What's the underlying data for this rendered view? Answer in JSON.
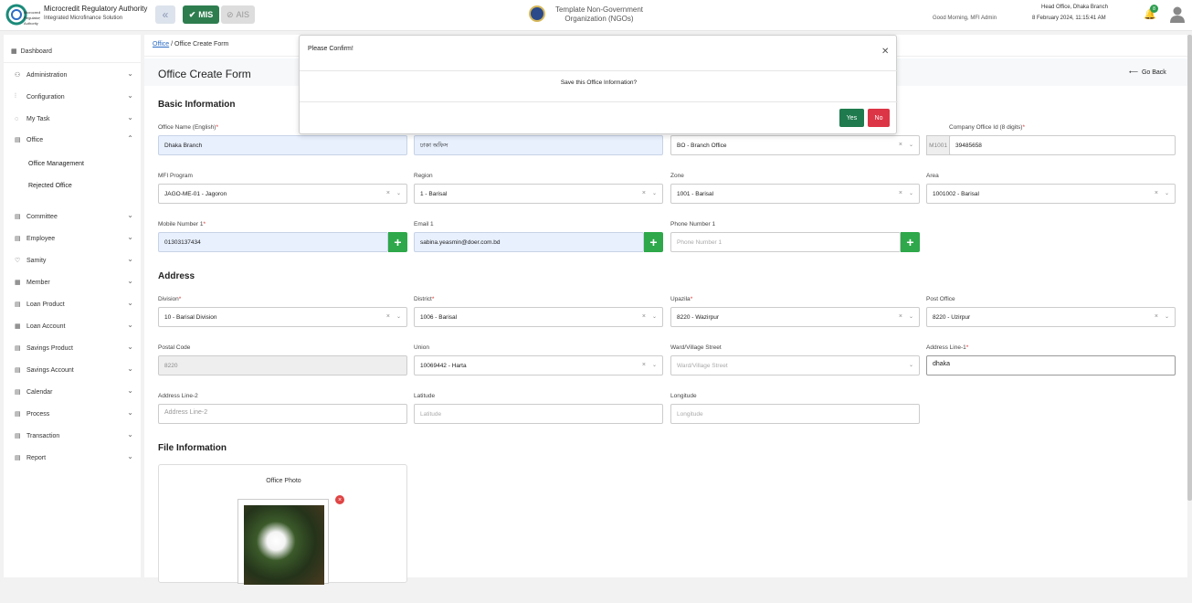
{
  "header": {
    "brand_title": "Microcredit Regulatory Authority",
    "brand_subtitle": "Integrated Microfinance Solution",
    "mis_label": "MIS",
    "ais_label": "AIS",
    "org_name": "Template Non-Government Organization (NGOs)",
    "greeting": "Good Morning, MFI Admin",
    "branch": "Head Office, Dhaka Branch",
    "datetime": "8 February 2024, 11:15:41 AM",
    "notification_count": "8"
  },
  "sidebar": {
    "dashboard": "Dashboard",
    "items": [
      {
        "label": "Administration",
        "icon": "users-icon"
      },
      {
        "label": "Configuration",
        "icon": "sliders-icon"
      },
      {
        "label": "My Task",
        "icon": "task-icon"
      },
      {
        "label": "Office",
        "icon": "office-icon"
      },
      {
        "label": "Committee",
        "icon": "committee-icon"
      },
      {
        "label": "Employee",
        "icon": "employee-icon"
      },
      {
        "label": "Samity",
        "icon": "samity-icon"
      },
      {
        "label": "Member",
        "icon": "member-icon"
      },
      {
        "label": "Loan Product",
        "icon": "loan-product-icon"
      },
      {
        "label": "Loan Account",
        "icon": "loan-account-icon"
      },
      {
        "label": "Savings Product",
        "icon": "savings-product-icon"
      },
      {
        "label": "Savings Account",
        "icon": "savings-account-icon"
      },
      {
        "label": "Calendar",
        "icon": "calendar-icon"
      },
      {
        "label": "Process",
        "icon": "process-icon"
      },
      {
        "label": "Transaction",
        "icon": "transaction-icon"
      },
      {
        "label": "Report",
        "icon": "report-icon"
      }
    ],
    "office_submenu": [
      "Office Management",
      "Rejected Office"
    ]
  },
  "breadcrumb": {
    "parent": "Office",
    "current": "Office Create Form"
  },
  "page": {
    "title": "Office Create Form",
    "go_back": "Go Back"
  },
  "sections": {
    "basic": "Basic Information",
    "address": "Address",
    "file": "File Information"
  },
  "form": {
    "office_name_en": {
      "label": "Office Name (English)",
      "value": "Dhaka Branch"
    },
    "office_name_bn": {
      "value": "ঢাকা অফিস"
    },
    "office_type": {
      "value": "BO - Branch Office"
    },
    "company_office_id": {
      "label": "Company Office Id (8 digits)",
      "prefix": "M1001",
      "value": "39485658"
    },
    "mfi_program": {
      "label": "MFI Program",
      "value": "JAGO-ME-01 - Jagoron"
    },
    "region": {
      "label": "Region",
      "value": "1 - Barisal"
    },
    "zone": {
      "label": "Zone",
      "value": "1001 - Barisal"
    },
    "area": {
      "label": "Area",
      "value": "1001002 - Barisal"
    },
    "mobile": {
      "label": "Mobile Number 1",
      "value": "01303137434"
    },
    "email": {
      "label": "Email 1",
      "value": "sabina.yeasmin@doer.com.bd"
    },
    "phone": {
      "label": "Phone Number 1",
      "placeholder": "Phone Number 1"
    },
    "division": {
      "label": "Division",
      "value": "10 - Barisal Division"
    },
    "district": {
      "label": "District",
      "value": "1006 - Barisal"
    },
    "upazila": {
      "label": "Upazila",
      "value": "8220 - Wazirpur"
    },
    "post_office": {
      "label": "Post Office",
      "value": "8220 - Uzirpur"
    },
    "postal_code": {
      "label": "Postal Code",
      "value": "8220"
    },
    "union": {
      "label": "Union",
      "value": "10069442 - Harta"
    },
    "ward": {
      "label": "Ward/Village Street",
      "placeholder": "Ward/Village Street"
    },
    "address1": {
      "label": "Address Line-1",
      "value": "dhaka"
    },
    "address2": {
      "label": "Address Line-2",
      "placeholder": "Address Line-2"
    },
    "latitude": {
      "label": "Latitude",
      "placeholder": "Latitude"
    },
    "longitude": {
      "label": "Longitude",
      "placeholder": "Longitude"
    },
    "office_photo": {
      "label": "Office Photo"
    }
  },
  "modal": {
    "title": "Please Confirm!",
    "message": "Save this Office Information?",
    "yes": "Yes",
    "no": "No"
  },
  "colors": {
    "accent_green": "#2e7d4f",
    "plus_green": "#2ea84a",
    "danger": "#dc3545",
    "filled_bg": "#e8f0fe"
  }
}
